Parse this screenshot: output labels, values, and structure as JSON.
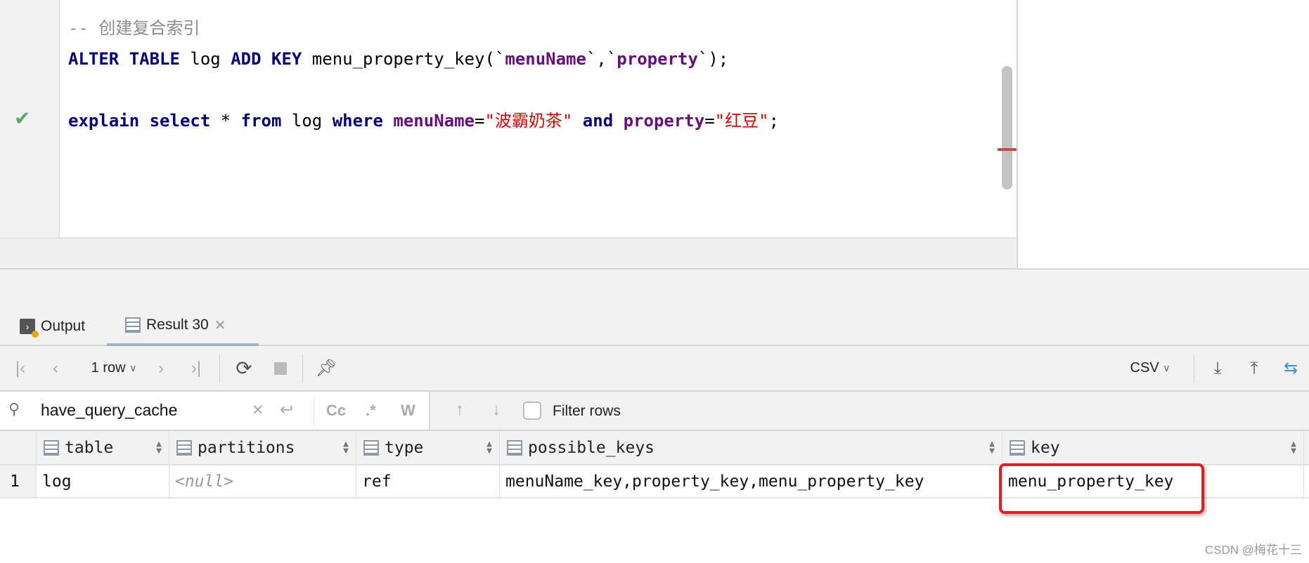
{
  "editor": {
    "comment": "-- 创建复合索引",
    "line1": {
      "kw1": "ALTER TABLE",
      "t1": " log ",
      "kw2": "ADD KEY",
      "t2": " menu_property_key(`",
      "c1": "menuName",
      "t3": "`,`",
      "c2": "property",
      "t4": "`);"
    },
    "line2": {
      "kw1": "explain select",
      "t1": " * ",
      "kw2": "from",
      "t2": " log ",
      "kw3": "where",
      "c1": "menuName",
      "t3": "=",
      "s1": "\"波霸奶茶\"",
      "kw4": " and ",
      "c2": "property",
      "t4": "=",
      "s2": "\"红豆\"",
      "t5": ";"
    },
    "status_icon": "check-icon"
  },
  "tabs": [
    {
      "label": "Output",
      "icon": "console-icon"
    },
    {
      "label": "Result 30",
      "icon": "table-icon"
    }
  ],
  "toolbar": {
    "rows": "1 row",
    "format": "CSV"
  },
  "search": {
    "value": "have_query_cache",
    "filter_label": "Filter rows",
    "filter_checked": false,
    "opt_case": "Cc",
    "opt_regex": ".*",
    "opt_word": "W"
  },
  "table": {
    "columns": [
      "table",
      "partitions",
      "type",
      "possible_keys",
      "key"
    ],
    "rows": [
      {
        "num": "1",
        "cells": [
          "log",
          "<null>",
          "ref",
          "menuName_key,property_key,menu_property_key",
          "menu_property_key"
        ]
      }
    ]
  },
  "colors": {
    "highlight": "#e51c23",
    "keyword": "#000080",
    "identifier": "#660e7a",
    "string": "#e00000"
  },
  "watermark": "CSDN @梅花十三"
}
